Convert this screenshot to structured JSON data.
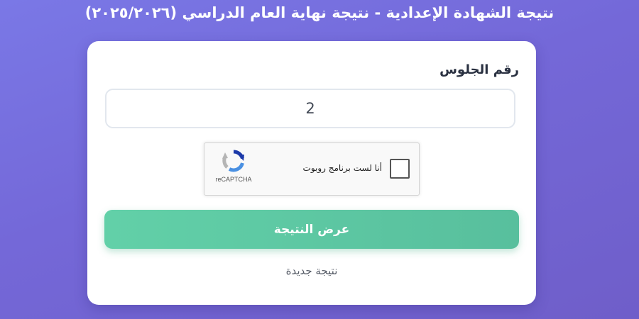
{
  "page": {
    "title": "نتيجة الشهادة الإعدادية - نتيجة نهاية العام الدراسي (٢٠٢٥/٢٠٢٦)"
  },
  "form": {
    "seat_label": "رقم الجلوس",
    "seat_value": "2",
    "captcha": {
      "label": "أنا لست برنامج روبوت",
      "brand": "reCAPTCHA",
      "icon": "recaptcha-logo-icon"
    },
    "submit_label": "عرض النتيجة",
    "new_result_label": "نتيجة جديدة"
  },
  "colors": {
    "background": "#7468d8",
    "button": "#5fc9a3",
    "card": "#ffffff"
  }
}
